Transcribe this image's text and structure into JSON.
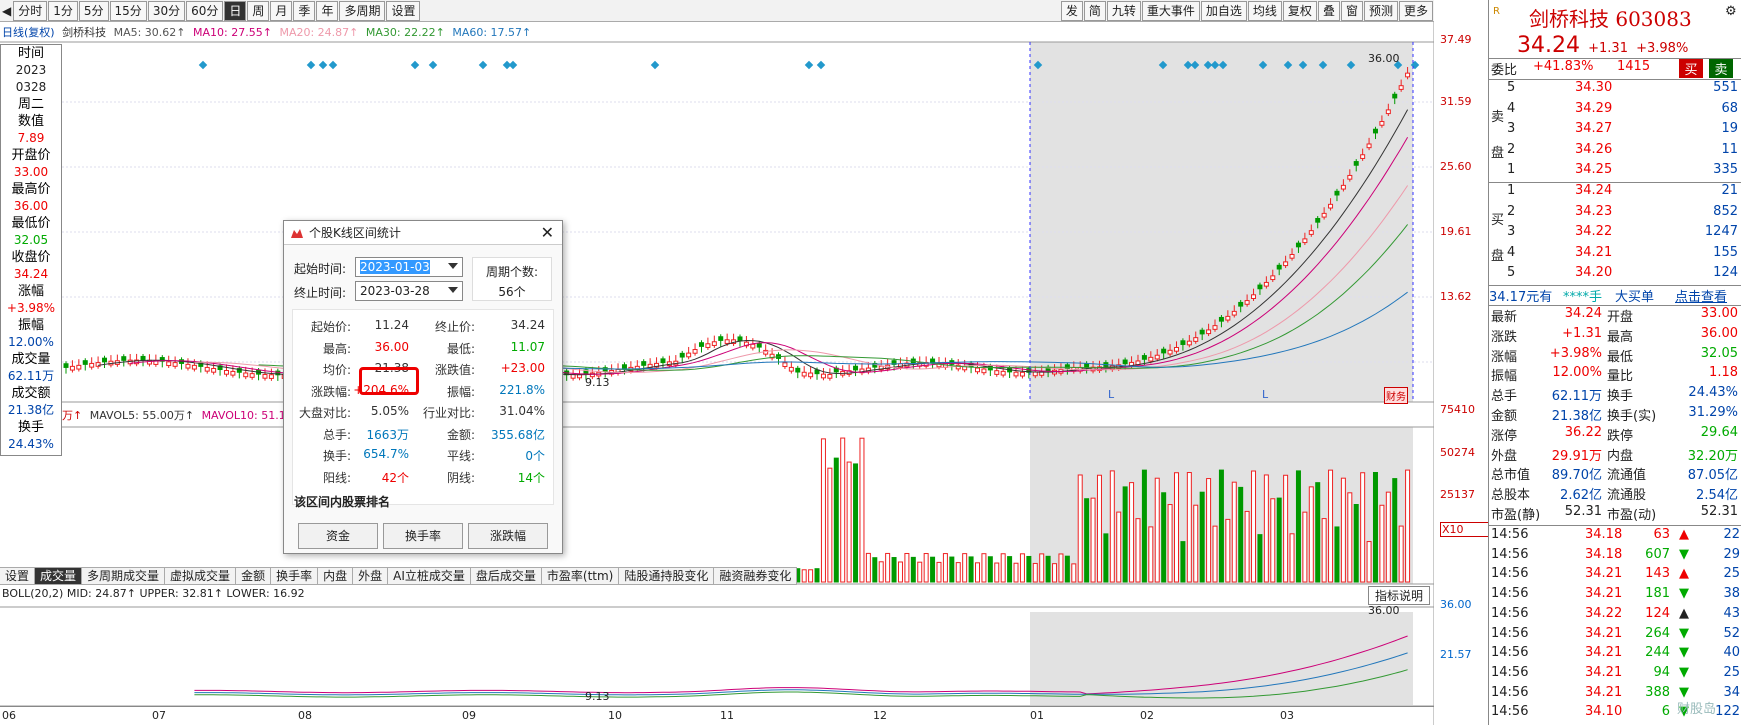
{
  "toolbar": {
    "left_buttons": [
      "分时",
      "1分",
      "5分",
      "15分",
      "30分",
      "60分",
      "日",
      "周",
      "月",
      "季",
      "年",
      "多周期",
      "设置"
    ],
    "active": "日",
    "right_buttons": [
      "发",
      "简",
      "九转",
      "重大事件",
      "加自选",
      "均线",
      "复权",
      "叠",
      "窗",
      "预测",
      "更多"
    ]
  },
  "legend_top": {
    "label": "日线(复权)",
    "stock": "剑桥科技",
    "ma5": "MA5: 30.62↑",
    "ma10": "MA10: 27.55↑",
    "ma20": "MA20: 24.87↑",
    "ma30": "MA30: 22.22↑",
    "ma60": "MA60: 17.57↑"
  },
  "info_col": [
    {
      "label": "时间",
      "value": "2023"
    },
    {
      "label": "",
      "value": "0328"
    },
    {
      "label": "周二",
      "value": ""
    },
    {
      "label": "数值",
      "value": "7.89"
    },
    {
      "label": "开盘价",
      "value": "33.00"
    },
    {
      "label": "最高价",
      "value": "36.00"
    },
    {
      "label": "最低价",
      "value": "32.05"
    },
    {
      "label": "收盘价",
      "value": "34.24"
    },
    {
      "label": "涨幅",
      "value": "+3.98%"
    },
    {
      "label": "振幅",
      "value": "12.00%"
    },
    {
      "label": "成交量",
      "value": "62.11万"
    },
    {
      "label": "成交额",
      "value": "21.38亿"
    },
    {
      "label": "换手",
      "value": "24.43%"
    }
  ],
  "price_axis": [
    "37.49",
    "31.59",
    "25.60",
    "19.61",
    "13.62"
  ],
  "price_marks": {
    "high": "36.00",
    "low": "9.13"
  },
  "vol_axis": [
    "75410",
    "50274",
    "25137",
    "X10"
  ],
  "vol_legend": {
    "prefix": "万↑",
    "mavol5": "MAVOL5: 55.00万↑",
    "mavol10": "MAVOL10: 51.12"
  },
  "tabs": [
    "设置",
    "成交量",
    "多周期成交量",
    "虚拟成交量",
    "金额",
    "换手率",
    "内盘",
    "外盘",
    "AI立桩成交量",
    "盘后成交量",
    "市盈率(ttm)",
    "陆股通持股变化",
    "融资融券变化"
  ],
  "active_tab": "成交量",
  "boll": {
    "legend": "BOLL(20,2) MID: 24.87↑ UPPER: 32.81↑ LOWER: 16.92",
    "axis": [
      "36.00",
      "21.57"
    ],
    "high": "36.00",
    "low": "9.13",
    "help": "指标说明"
  },
  "x_axis": [
    "06",
    "07",
    "08",
    "09",
    "10",
    "11",
    "12",
    "01",
    "02",
    "03"
  ],
  "markers": {
    "l1": "L",
    "l2": "L",
    "cw": "财务"
  },
  "dialog": {
    "title": "个股K线区间统计",
    "start_label": "起始时间:",
    "start_value": "2023-01-03",
    "end_label": "终止时间:",
    "end_value": "2023-03-28",
    "period_label": "周期个数:",
    "period_value": "56个",
    "stats": [
      {
        "l": "起始价:",
        "v": "11.24",
        "l2": "终止价:",
        "v2": "34.24"
      },
      {
        "l": "最高:",
        "v": "36.00",
        "l2": "最低:",
        "v2": "11.07"
      },
      {
        "l": "均价:",
        "v": "21.38",
        "l2": "涨跌值:",
        "v2": "+23.00"
      },
      {
        "l": "涨跌幅:",
        "v": "+204.6%",
        "l2": "振幅:",
        "v2": "221.8%"
      },
      {
        "l": "大盘对比:",
        "v": "5.05%",
        "l2": "行业对比:",
        "v2": "31.04%"
      },
      {
        "l": "总手:",
        "v": "1663万",
        "l2": "金额:",
        "v2": "355.68亿"
      },
      {
        "l": "换手:",
        "v": "654.7%",
        "l2": "平线:",
        "v2": "0个"
      },
      {
        "l": "阳线:",
        "v": "42个",
        "l2": "阴线:",
        "v2": "14个"
      }
    ],
    "rank_title": "该区间内股票排名",
    "btn_fund": "资金",
    "btn_turnover": "换手率",
    "btn_change": "涨跌幅"
  },
  "right_panel": {
    "logo": "R",
    "name": "剑桥科技",
    "code": "603083",
    "price": "34.24",
    "change": "+1.31",
    "change_pct": "+3.98%",
    "weibi_label": "委比",
    "weibi_value": "+41.83%",
    "weibi_diff": "1415",
    "buy_btn": "买",
    "sell_btn": "卖",
    "sell_label": "卖盘",
    "buy_label": "买盘",
    "sells": [
      {
        "lv": "5",
        "p": "34.30",
        "v": "551"
      },
      {
        "lv": "4",
        "p": "34.29",
        "v": "68"
      },
      {
        "lv": "3",
        "p": "34.27",
        "v": "19"
      },
      {
        "lv": "2",
        "p": "34.26",
        "v": "11"
      },
      {
        "lv": "1",
        "p": "34.25",
        "v": "335"
      }
    ],
    "buys": [
      {
        "lv": "1",
        "p": "34.24",
        "v": "21"
      },
      {
        "lv": "2",
        "p": "34.23",
        "v": "852"
      },
      {
        "lv": "3",
        "p": "34.22",
        "v": "1247"
      },
      {
        "lv": "4",
        "p": "34.21",
        "v": "155"
      },
      {
        "lv": "5",
        "p": "34.20",
        "v": "124"
      }
    ],
    "bigbuy": {
      "a": "34.17元有",
      "b": "****手",
      "c": "大买单",
      "d": "点击查看"
    },
    "quotes": [
      {
        "l": "最新",
        "v": "34.24",
        "l2": "开盘",
        "v2": "33.00"
      },
      {
        "l": "涨跌",
        "v": "+1.31",
        "l2": "最高",
        "v2": "36.00"
      },
      {
        "l": "涨幅",
        "v": "+3.98%",
        "l2": "最低",
        "v2": "32.05"
      },
      {
        "l": "振幅",
        "v": "12.00%",
        "l2": "量比",
        "v2": "1.18"
      },
      {
        "l": "总手",
        "v": "62.11万",
        "l2": "换手",
        "v2": "24.43%"
      },
      {
        "l": "金额",
        "v": "21.38亿",
        "l2": "换手(实)",
        "v2": "31.29%"
      },
      {
        "l": "涨停",
        "v": "36.22",
        "l2": "跌停",
        "v2": "29.64"
      },
      {
        "l": "外盘",
        "v": "29.91万",
        "l2": "内盘",
        "v2": "32.20万"
      },
      {
        "l": "总市值",
        "v": "89.70亿",
        "l2": "流通值",
        "v2": "87.05亿"
      },
      {
        "l": "总股本",
        "v": "2.62亿",
        "l2": "流通股",
        "v2": "2.54亿"
      },
      {
        "l": "市盈(静)",
        "v": "52.31",
        "l2": "市盈(动)",
        "v2": "52.31"
      }
    ],
    "ticks": [
      {
        "t": "14:56",
        "p": "34.18",
        "v": "63",
        "d": "up",
        "n": "22"
      },
      {
        "t": "14:56",
        "p": "34.18",
        "v": "607",
        "d": "down",
        "n": "29"
      },
      {
        "t": "14:56",
        "p": "34.21",
        "v": "143",
        "d": "up",
        "n": "25"
      },
      {
        "t": "14:56",
        "p": "34.21",
        "v": "181",
        "d": "down",
        "n": "38"
      },
      {
        "t": "14:56",
        "p": "34.22",
        "v": "124",
        "d": "up2",
        "n": "43"
      },
      {
        "t": "14:56",
        "p": "34.21",
        "v": "264",
        "d": "down",
        "n": "52"
      },
      {
        "t": "14:56",
        "p": "34.21",
        "v": "244",
        "d": "down",
        "n": "40"
      },
      {
        "t": "14:56",
        "p": "34.21",
        "v": "94",
        "d": "down",
        "n": "25"
      },
      {
        "t": "14:56",
        "p": "34.21",
        "v": "388",
        "d": "down",
        "n": "34"
      },
      {
        "t": "14:56",
        "p": "34.10",
        "v": "6",
        "d": "down",
        "n": "122"
      }
    ],
    "watermark": "财股岛"
  }
}
